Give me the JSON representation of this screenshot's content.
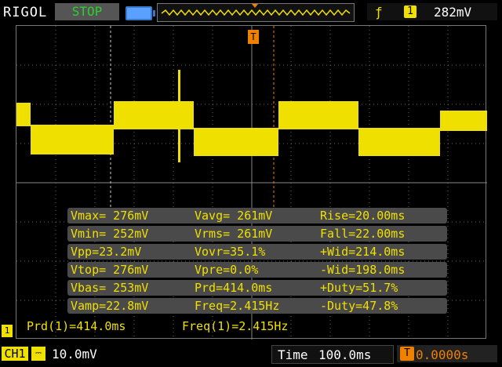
{
  "header": {
    "brand": "RIGOL",
    "run_status": "STOP",
    "trigger_edge_icon": "rising-edge-icon",
    "trigger_channel": "1",
    "trigger_level": "282mV"
  },
  "colors": {
    "channel1": "#f0e000",
    "trigger": "#f08000",
    "status_green": "#2bd12b"
  },
  "measurements": [
    [
      "Vmax= 276mV",
      "Vavg= 261mV",
      "Rise=20.00ms"
    ],
    [
      "Vmin= 252mV",
      "Vrms= 261mV",
      "Fall=22.00ms"
    ],
    [
      "Vpp=23.2mV",
      "Vovr=35.1%",
      "+Wid=214.0ms"
    ],
    [
      "Vtop= 276mV",
      "Vpre=0.0%",
      "-Wid=198.0ms"
    ],
    [
      "Vbas= 253mV",
      "Prd=414.0ms",
      "+Duty=51.7%"
    ],
    [
      "Vamp=22.8mV",
      "Freq=2.415Hz",
      "-Duty=47.8%"
    ]
  ],
  "readout": {
    "period": "Prd(1)=414.0ms",
    "frequency": "Freq(1)=2.415Hz"
  },
  "footer": {
    "channel_label": "CH1",
    "coupling_icon": "dc-coupling-icon",
    "vertical_scale": "10.0mV",
    "time_label": "Time",
    "time_scale": "100.0ms",
    "trigger_offset_icon": "trigger-offset-icon",
    "trigger_offset": "0.0000s"
  },
  "markers": {
    "trigger_marker": "T",
    "ground_marker": "1"
  }
}
